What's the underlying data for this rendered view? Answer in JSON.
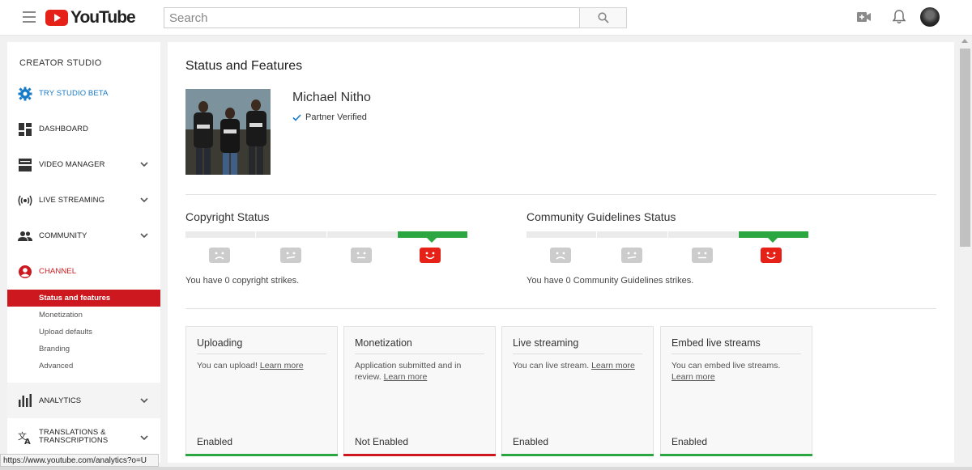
{
  "header": {
    "logo_text": "YouTube",
    "search_placeholder": "Search"
  },
  "sidebar": {
    "title": "CREATOR STUDIO",
    "items": [
      {
        "label": "TRY STUDIO BETA",
        "icon": "gear-icon"
      },
      {
        "label": "DASHBOARD",
        "icon": "dashboard-icon"
      },
      {
        "label": "VIDEO MANAGER",
        "icon": "video-manager-icon"
      },
      {
        "label": "LIVE STREAMING",
        "icon": "live-streaming-icon"
      },
      {
        "label": "COMMUNITY",
        "icon": "community-icon"
      },
      {
        "label": "CHANNEL",
        "icon": "channel-icon"
      },
      {
        "label": "ANALYTICS",
        "icon": "analytics-icon"
      },
      {
        "label_line1": "TRANSLATIONS &",
        "label_line2": "TRANSCRIPTIONS",
        "icon": "translate-icon"
      }
    ],
    "channel_sub": [
      {
        "label": "Status and features",
        "active": true
      },
      {
        "label": "Monetization"
      },
      {
        "label": "Upload defaults"
      },
      {
        "label": "Branding"
      },
      {
        "label": "Advanced"
      }
    ]
  },
  "main": {
    "title": "Status and Features",
    "channel_name": "Michael Nitho",
    "verified_label": "Partner Verified",
    "copyright": {
      "title": "Copyright Status",
      "text": "You have 0 copyright strikes."
    },
    "community": {
      "title": "Community Guidelines Status",
      "text": "You have 0 Community Guidelines strikes."
    },
    "cards": [
      {
        "title": "Uploading",
        "desc": "You can upload!",
        "link": "Learn more",
        "status": "Enabled"
      },
      {
        "title": "Monetization",
        "desc": "Application submitted and in review.",
        "link": "Learn more",
        "status": "Not Enabled"
      },
      {
        "title": "Live streaming",
        "desc": "You can live stream.",
        "link": "Learn more",
        "status": "Enabled"
      },
      {
        "title": "Embed live streams",
        "desc": "You can embed live streams.",
        "link": "Learn more",
        "status": "Enabled"
      }
    ]
  },
  "statusbar": {
    "url": "https://www.youtube.com/analytics?o=U"
  },
  "colors": {
    "brand_red": "#e62117",
    "active_red": "#cc181e",
    "status_green": "#2ba640",
    "link_blue": "#167ac6"
  }
}
